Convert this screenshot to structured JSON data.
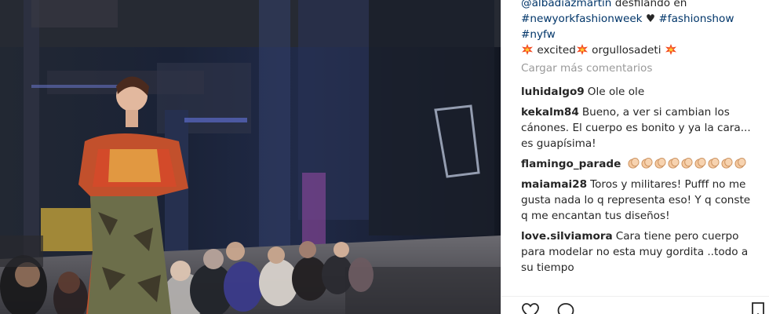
{
  "post": {
    "caption_lines": {
      "line1_mention": "@albadiazmartin",
      "line1_text": "desfilando en",
      "hashtag_1": "#newyorkfashionweek",
      "heart": "♥",
      "hashtag_2": "#fashionshow",
      "hashtag_3": "#nyfw",
      "word_excited": "excited",
      "word_orgullosa": "orgullosadeti"
    },
    "load_more_label": "Cargar más comentarios",
    "comments": [
      {
        "user": "luhidalgo9",
        "text": "Ole ole ole"
      },
      {
        "user": "kekalm84",
        "text": "Bueno, a ver si cambian los cánones. El cuerpo es bonito y ya la cara... es guapísima!"
      },
      {
        "user": "flamingo_parade",
        "text": ""
      },
      {
        "user": "maiamai28",
        "text": "Toros y militares! Pufff no me gusta nada lo q representa eso! Y q conste q me encantan tus diseños!"
      },
      {
        "user": "love.silviamora",
        "text": "Cara tiene pero cuerpo para modelar no esta muy gordita ..todo a su tiempo"
      }
    ]
  },
  "icons": {
    "fire": "collision-emoji",
    "clap": "clapping-hands-emoji",
    "like": "heart-icon",
    "comment": "comment-bubble-icon",
    "save": "bookmark-icon"
  },
  "colors": {
    "text": "#262626",
    "link": "#003569",
    "muted": "#999999"
  }
}
